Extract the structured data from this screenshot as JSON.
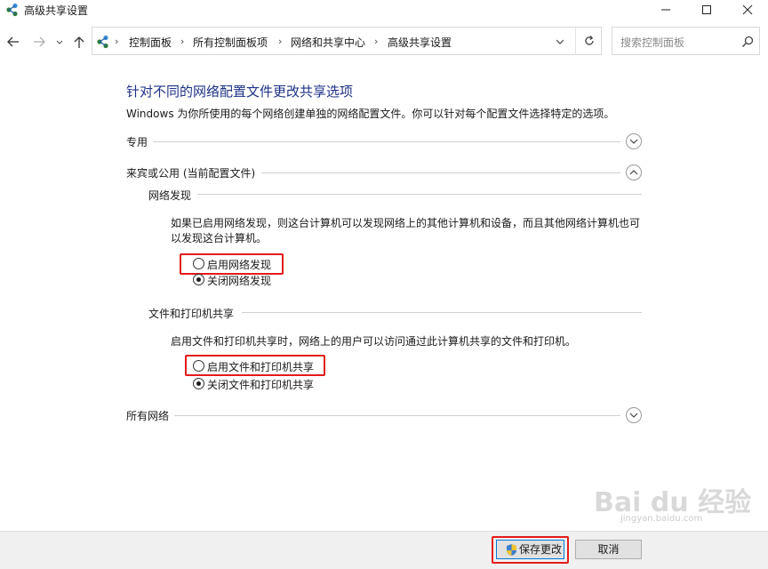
{
  "window": {
    "title": "高级共享设置",
    "app_icon": "network-icon",
    "controls": [
      "minimize-icon",
      "maximize-icon",
      "close-icon"
    ]
  },
  "navigation": {
    "breadcrumb": [
      "控制面板",
      "所有控制面板项",
      "网络和共享中心",
      "高级共享设置"
    ],
    "search_placeholder": "搜索控制面板"
  },
  "content": {
    "heading": "针对不同的网络配置文件更改共享选项",
    "description": "Windows 为你所使用的每个网络创建单独的网络配置文件。你可以针对每个配置文件选择特定的选项。",
    "profiles": [
      {
        "label": "专用",
        "expanded": false
      },
      {
        "label": "来宾或公用 (当前配置文件)",
        "expanded": true
      },
      {
        "label": "所有网络",
        "expanded": false
      }
    ],
    "network_discovery": {
      "title": "网络发现",
      "description": "如果已启用网络发现，则这台计算机可以发现网络上的其他计算机和设备，而且其他网络计算机也可以发现这台计算机。",
      "options": [
        {
          "label": "启用网络发现",
          "selected": false,
          "highlighted": true
        },
        {
          "label": "关闭网络发现",
          "selected": true,
          "highlighted": false
        }
      ]
    },
    "file_printer_sharing": {
      "title": "文件和打印机共享",
      "description": "启用文件和打印机共享时，网络上的用户可以访问通过此计算机共享的文件和打印机。",
      "options": [
        {
          "label": "启用文件和打印机共享",
          "selected": false,
          "highlighted": true
        },
        {
          "label": "关闭文件和打印机共享",
          "selected": true,
          "highlighted": false
        }
      ]
    }
  },
  "footer": {
    "save_label": "保存更改",
    "save_icon": "shield-icon",
    "save_highlighted": true,
    "cancel_label": "取消"
  },
  "watermark": {
    "logo_text": "Bai du 经验",
    "url": "jingyan.baidu.com"
  },
  "colors": {
    "heading": "#1e3287",
    "highlight": "#e31b1b",
    "footer_bg": "#f0f0f0",
    "primary_border": "#0078d7"
  }
}
